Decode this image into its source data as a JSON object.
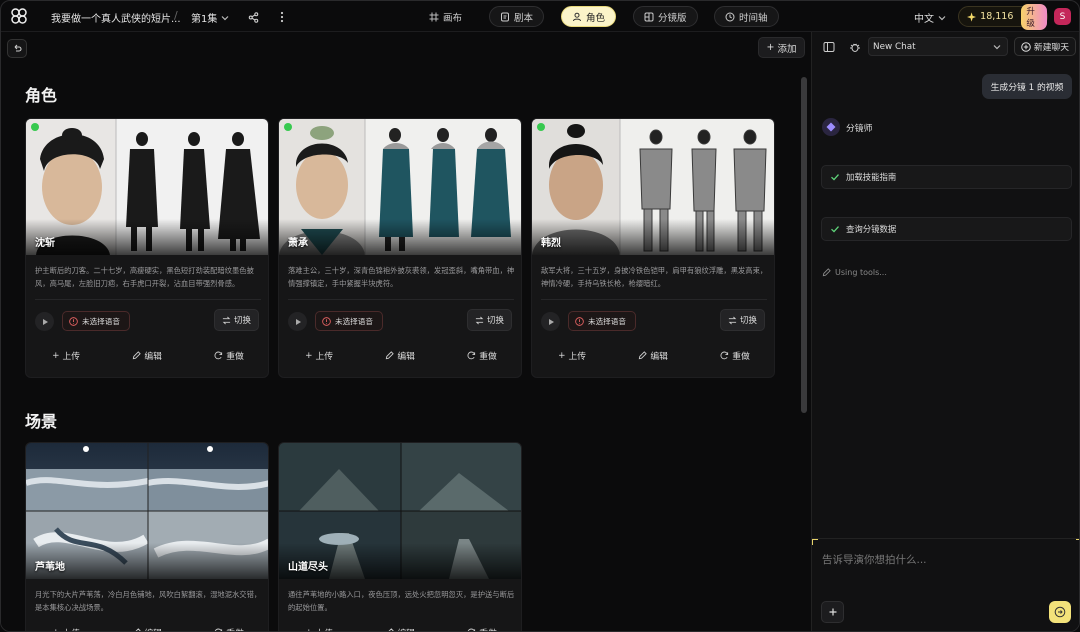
{
  "topbar": {
    "project_title": "我要做一个真人武侠的短片...",
    "episode": "第1集",
    "tabs": [
      {
        "label": "画布",
        "icon": "canvas-icon"
      },
      {
        "label": "剧本",
        "icon": "script-icon"
      },
      {
        "label": "角色",
        "icon": "character-icon"
      },
      {
        "label": "分镜版",
        "icon": "storyboard-icon"
      },
      {
        "label": "时间轴",
        "icon": "timeline-icon"
      }
    ],
    "active_tab": "角色",
    "language": "中文",
    "credits": "18,116",
    "upgrade_label": "升级",
    "avatar_initial": "S"
  },
  "main": {
    "add_label": "添加",
    "characters_title": "角色",
    "scenes_title": "场景",
    "voice_status": "未选择语音",
    "switch_label": "切换",
    "upload_label": "上传",
    "edit_label": "编辑",
    "redo_label": "重做",
    "characters": [
      {
        "name": "沈斩",
        "desc": "护主断后的刀客。二十七岁，高瘦硬实，黑色短打劲装配暗纹墨色披风，高马尾，左脸旧刀疤，右手虎口开裂，沾血目带强烈骨感。"
      },
      {
        "name": "萧承",
        "desc": "落难主公，三十岁，深青色锦袍外披灰裘领，发冠歪斜，嘴角带血，神情强撑镇定，手中紧握半块虎符。"
      },
      {
        "name": "韩烈",
        "desc": "敌军大将，三十五岁，身披冷铁色铠甲，肩甲有狼纹浮雕，黑发高束，神情冷硬，手持乌铁长枪，枪缨暗红。"
      }
    ],
    "scenes": [
      {
        "name": "芦苇地",
        "desc": "月光下的大片芦苇荡，冷白月色铺地，风吹白絮翻滚，湿地泥水交错，是本集核心决战场景。"
      },
      {
        "name": "山道尽头",
        "desc": "通往芦苇地的小路入口，夜色压顶，远处火把忽明忽灭，是护送与断后的起始位置。"
      }
    ]
  },
  "chat": {
    "selector": "New Chat",
    "new_chat_label": "新建聊天",
    "user_message": "生成分镜 1 的视频",
    "agent_name": "分镜师",
    "tools": [
      "加载技能指南",
      "查询分镜数据"
    ],
    "using_tools": "Using tools...",
    "input_placeholder": "告诉导演你想拍什么..."
  },
  "colors": {
    "accent": "#fbf4c9",
    "status_green": "#37c94f",
    "send": "#f3e27a"
  }
}
